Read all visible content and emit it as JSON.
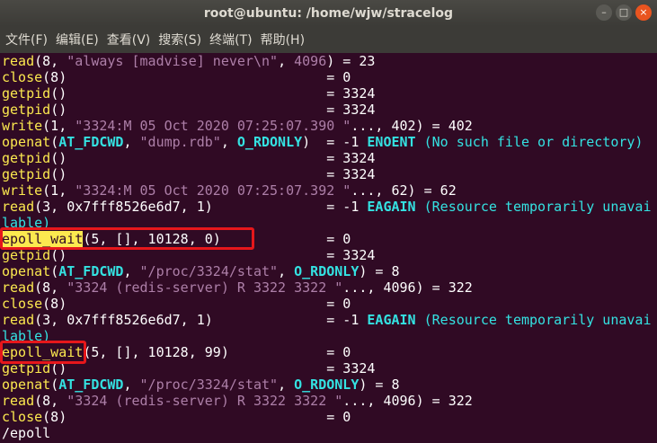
{
  "window": {
    "title": "root@ubuntu: /home/wjw/stracelog",
    "controls": {
      "minimize": "–",
      "maximize": "□",
      "close": "×"
    }
  },
  "menu": [
    "文件(F)",
    "编辑(E)",
    "查看(V)",
    "搜索(S)",
    "终端(T)",
    "帮助(H)"
  ],
  "terminal": {
    "lines": [
      [
        {
          "t": "read",
          "c": "fn"
        },
        {
          "t": "(8, ",
          "c": "t"
        },
        {
          "t": "\"always [madvise] never\\n\"",
          "c": "s"
        },
        {
          "t": ", ",
          "c": "t"
        },
        {
          "t": "4096",
          "c": "n"
        },
        {
          "t": ") = 23",
          "c": "t"
        }
      ],
      [
        {
          "t": "close",
          "c": "fn"
        },
        {
          "t": "(8)                                = 0",
          "c": "t"
        }
      ],
      [
        {
          "t": "getpid",
          "c": "fn"
        },
        {
          "t": "()                                = 3324",
          "c": "t"
        }
      ],
      [
        {
          "t": "getpid",
          "c": "fn"
        },
        {
          "t": "()                                = 3324",
          "c": "t"
        }
      ],
      [
        {
          "t": "write",
          "c": "fn"
        },
        {
          "t": "(1, ",
          "c": "t"
        },
        {
          "t": "\"3324:M 05 Oct 2020 07:25:07.390 \"",
          "c": "s"
        },
        {
          "t": "..., 402) = 402",
          "c": "t"
        }
      ],
      [
        {
          "t": "openat",
          "c": "fn"
        },
        {
          "t": "(",
          "c": "t"
        },
        {
          "t": "AT_FDCWD",
          "c": "k"
        },
        {
          "t": ", ",
          "c": "t"
        },
        {
          "t": "\"dump.rdb\"",
          "c": "s"
        },
        {
          "t": ", ",
          "c": "t"
        },
        {
          "t": "O_RDONLY",
          "c": "k"
        },
        {
          "t": ")  = -1 ",
          "c": "t"
        },
        {
          "t": "ENOENT",
          "c": "k"
        },
        {
          "t": " (No such file or directory)",
          "c": "e"
        }
      ],
      [
        {
          "t": "getpid",
          "c": "fn"
        },
        {
          "t": "()                                = 3324",
          "c": "t"
        }
      ],
      [
        {
          "t": "getpid",
          "c": "fn"
        },
        {
          "t": "()                                = 3324",
          "c": "t"
        }
      ],
      [
        {
          "t": "write",
          "c": "fn"
        },
        {
          "t": "(1, ",
          "c": "t"
        },
        {
          "t": "\"3324:M 05 Oct 2020 07:25:07.392 \"",
          "c": "s"
        },
        {
          "t": "..., 62) = 62",
          "c": "t"
        }
      ],
      [
        {
          "t": "read",
          "c": "fn"
        },
        {
          "t": "(3, 0x7fff8526e6d7, 1)              = -1 ",
          "c": "t"
        },
        {
          "t": "EAGAIN",
          "c": "k"
        },
        {
          "t": " (Resource temporarily unavai",
          "c": "e"
        }
      ],
      [
        {
          "t": "lable)",
          "c": "e"
        }
      ],
      [
        {
          "t": "epoll_wait",
          "c": "fn"
        },
        {
          "t": "(5, [], 10128, 0)             = 0",
          "c": "t"
        }
      ],
      [
        {
          "t": "getpid",
          "c": "fn"
        },
        {
          "t": "()                                = 3324",
          "c": "t"
        }
      ],
      [
        {
          "t": "openat",
          "c": "fn"
        },
        {
          "t": "(",
          "c": "t"
        },
        {
          "t": "AT_FDCWD",
          "c": "k"
        },
        {
          "t": ", ",
          "c": "t"
        },
        {
          "t": "\"/proc/3324/stat\"",
          "c": "s"
        },
        {
          "t": ", ",
          "c": "t"
        },
        {
          "t": "O_RDONLY",
          "c": "k"
        },
        {
          "t": ") = 8",
          "c": "t"
        }
      ],
      [
        {
          "t": "read",
          "c": "fn"
        },
        {
          "t": "(8, ",
          "c": "t"
        },
        {
          "t": "\"3324 (redis-server) R 3322 3322 \"",
          "c": "s"
        },
        {
          "t": "..., 4096) = 322",
          "c": "t"
        }
      ],
      [
        {
          "t": "close",
          "c": "fn"
        },
        {
          "t": "(8)                                = 0",
          "c": "t"
        }
      ],
      [
        {
          "t": "read",
          "c": "fn"
        },
        {
          "t": "(3, 0x7fff8526e6d7, 1)              = -1 ",
          "c": "t"
        },
        {
          "t": "EAGAIN",
          "c": "k"
        },
        {
          "t": " (Resource temporarily unavai",
          "c": "e"
        }
      ],
      [
        {
          "t": "lable)",
          "c": "e"
        }
      ],
      [
        {
          "t": "epoll_wait",
          "c": "fn"
        },
        {
          "t": "(5, [], 10128, 99)            = 0",
          "c": "t"
        }
      ],
      [
        {
          "t": "getpid",
          "c": "fn"
        },
        {
          "t": "()                                = 3324",
          "c": "t"
        }
      ],
      [
        {
          "t": "openat",
          "c": "fn"
        },
        {
          "t": "(",
          "c": "t"
        },
        {
          "t": "AT_FDCWD",
          "c": "k"
        },
        {
          "t": ", ",
          "c": "t"
        },
        {
          "t": "\"/proc/3324/stat\"",
          "c": "s"
        },
        {
          "t": ", ",
          "c": "t"
        },
        {
          "t": "O_RDONLY",
          "c": "k"
        },
        {
          "t": ") = 8",
          "c": "t"
        }
      ],
      [
        {
          "t": "read",
          "c": "fn"
        },
        {
          "t": "(8, ",
          "c": "t"
        },
        {
          "t": "\"3324 (redis-server) R 3322 3322 \"",
          "c": "s"
        },
        {
          "t": "..., 4096) = 322",
          "c": "t"
        }
      ],
      [
        {
          "t": "close",
          "c": "fn"
        },
        {
          "t": "(8)                                = 0",
          "c": "t"
        }
      ],
      [
        {
          "t": "/epoll",
          "c": "t"
        }
      ]
    ]
  },
  "colors": {
    "background": "#300a24",
    "function": "#fce94f",
    "string": "#ad7fa8",
    "constant": "#34e2e2",
    "highlight_border": "#e6171b"
  }
}
